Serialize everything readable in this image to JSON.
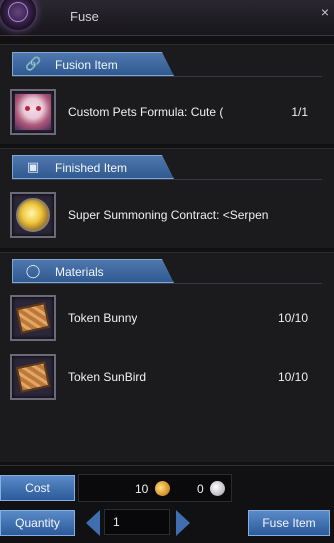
{
  "window": {
    "title": "Fuse",
    "close_glyph": "×"
  },
  "sections": {
    "fusion": {
      "label": "Fusion Item",
      "icon": "link-icon",
      "item_name": "Custom Pets Formula: Cute (",
      "count": "1/1"
    },
    "finished": {
      "label": "Finished Item",
      "icon": "box-icon",
      "item_name": "Super Summoning Contract: <Serpent"
    },
    "materials": {
      "label": "Materials",
      "icon": "bag-icon",
      "items": [
        {
          "name": "Token Bunny",
          "count": "10/10"
        },
        {
          "name": "Token SunBird",
          "count": "10/10"
        }
      ]
    }
  },
  "footer": {
    "cost_label": "Cost",
    "cost_gold": "10",
    "cost_silver": "0",
    "quantity_label": "Quantity",
    "quantity_value": "1",
    "fuse_label": "Fuse Item"
  },
  "colors": {
    "accent": "#3f6fb0",
    "header": "#2f5a90",
    "panel": "#1b1b1e"
  }
}
